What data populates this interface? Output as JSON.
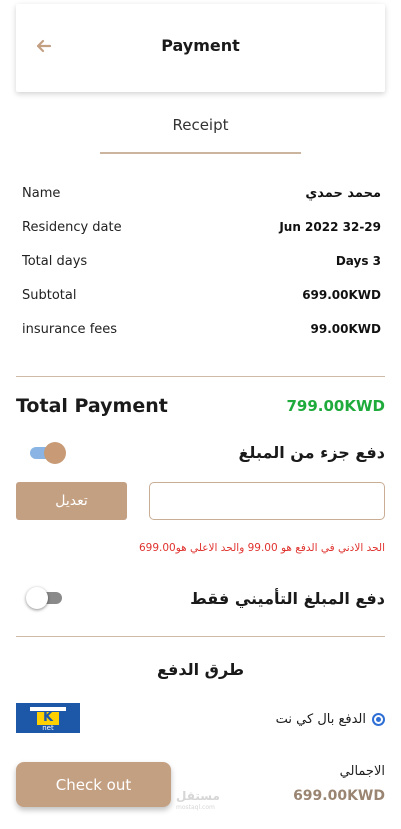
{
  "header": {
    "title": "Payment"
  },
  "receipt": {
    "tab_label": "Receipt",
    "rows": [
      {
        "label": "Name",
        "value": "محمد حمدي"
      },
      {
        "label": "Residency date",
        "value": "Jun 2022 32-29"
      },
      {
        "label": "Total days",
        "value": "Days 3"
      },
      {
        "label": "Subtotal",
        "value": "699.00KWD"
      },
      {
        "label": "insurance fees",
        "value": "99.00KWD"
      }
    ]
  },
  "total": {
    "label": "Total Payment",
    "value": "799.00KWD",
    "color": "#1faa3c"
  },
  "partial_payment": {
    "label": "دفع جزء من المبلغ",
    "enabled": true,
    "input_value": "",
    "edit_label": "تعديل",
    "limit_note": "الحد الادني في الدفع هو 99.00 والحد الاعلي هو699.00"
  },
  "insurance_only": {
    "label": "دفع المبلغ التأميني فقط",
    "enabled": false
  },
  "payment_methods": {
    "title": "طرق الدفع",
    "option_label": "الدفع بال كي نت",
    "selected": true,
    "logo_text": "K",
    "logo_subtext": "net"
  },
  "footer": {
    "checkout_label": "Check out",
    "grand_total_label": "الاجمالي",
    "grand_total_value": "699.00KWD"
  },
  "watermark": {
    "text": "مستقل",
    "subtext": "mostaql.com"
  },
  "colors": {
    "accent": "#c4a083",
    "toggle_on_track": "#8ab4e4",
    "error": "#e0332f",
    "knet_blue": "#1d57a8",
    "knet_yellow": "#ffd000"
  }
}
